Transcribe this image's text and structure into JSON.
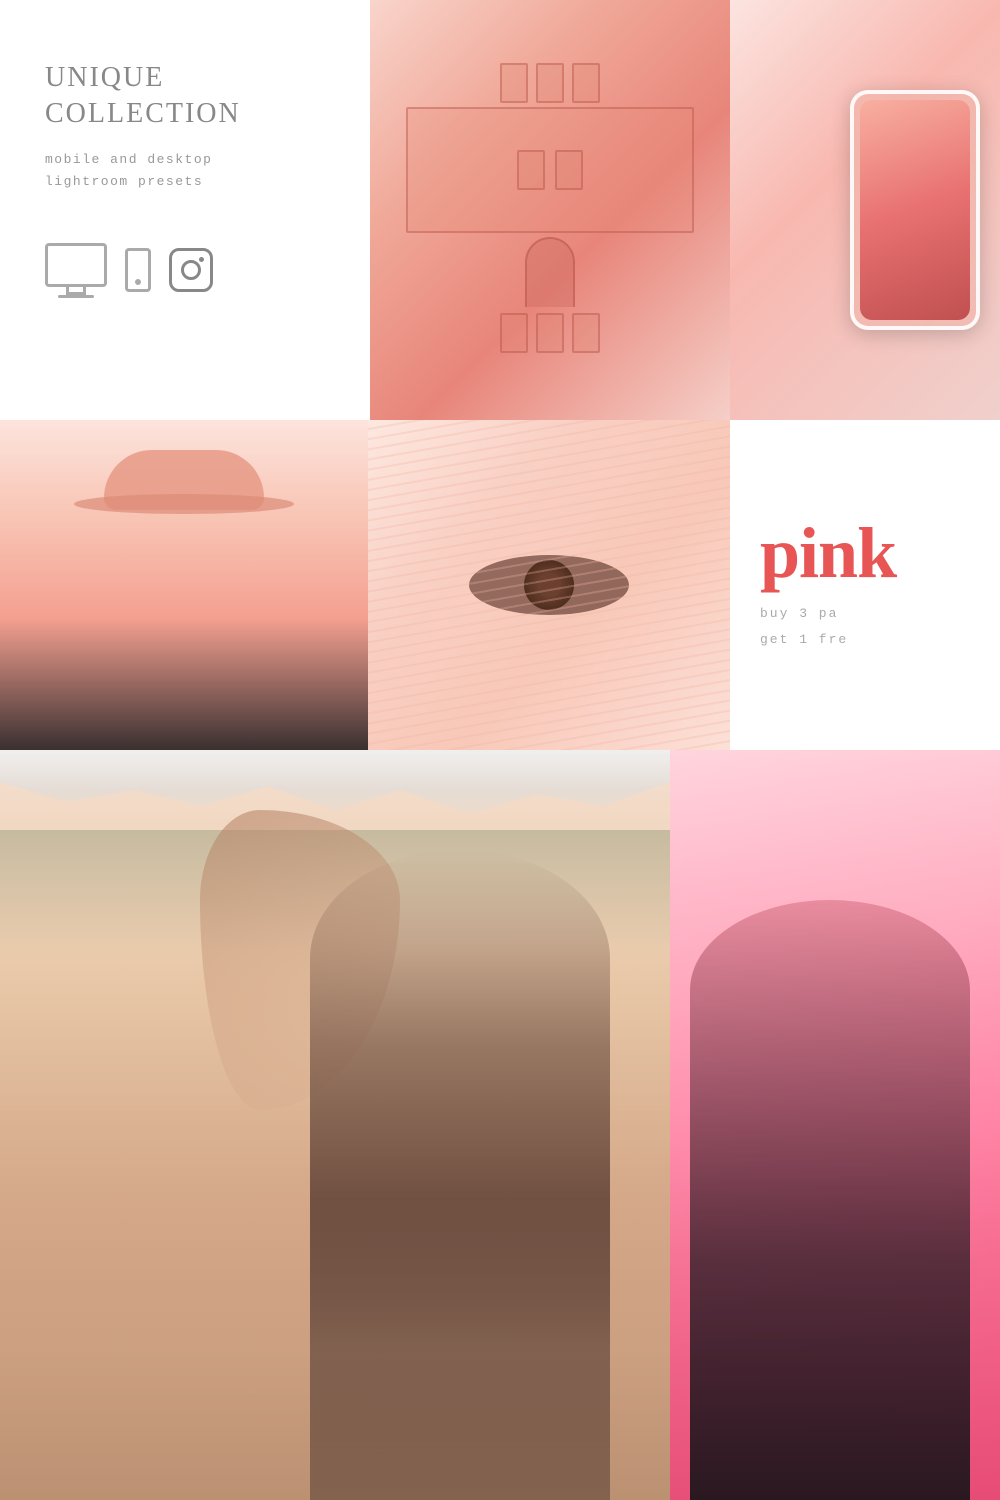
{
  "header": {
    "title_line1": "UNIQUE",
    "title_line2": "COLLECTION",
    "subtitle_line1": "mobile and desktop",
    "subtitle_line2": "lightroom presets"
  },
  "icons": {
    "monitor": "monitor-icon",
    "phone": "phone-icon",
    "instagram": "instagram-icon"
  },
  "middle": {
    "brand_word": "pink",
    "promo_line1": "buy 3 pa",
    "promo_line2": "get 1 fre"
  },
  "sections": {
    "top_left_bg": "#ffffff",
    "accent_color": "#e85555",
    "text_color": "#999999"
  }
}
